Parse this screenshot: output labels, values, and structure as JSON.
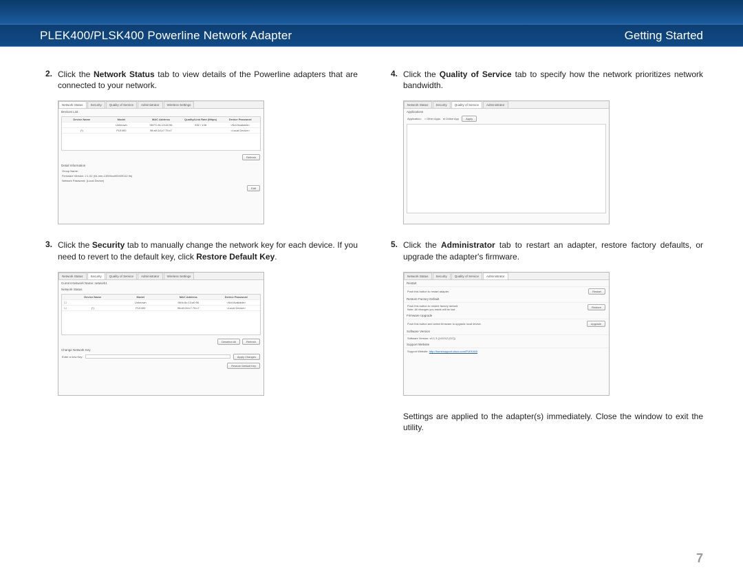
{
  "header": {
    "title": "PLEK400/PLSK400 Powerline Network Adapter",
    "section": "Getting Started"
  },
  "page_number": "7",
  "steps": {
    "s2": {
      "num": "2.",
      "pre": "Click the ",
      "bold": "Network Status",
      "post": " tab to view details of the Powerline adapters that are connected to your network."
    },
    "s3": {
      "num": "3.",
      "pre": "Click the ",
      "bold": "Security",
      "post_a": " tab to manually change the network key for each device. If you need to revert to the default key, click ",
      "bold2": "Restore Default Key",
      "post_b": "."
    },
    "s4": {
      "num": "4.",
      "pre": "Click the ",
      "bold": "Quality of Service",
      "post": " tab to specify how the network prioritizes network bandwidth."
    },
    "s5": {
      "num": "5.",
      "pre": "Click the ",
      "bold": "Administrator",
      "post": " tab to restart an adapter, restore factory defaults, or upgrade the adapter's firmware."
    }
  },
  "closing": "Settings are applied to the adapter(s) immediately. Close the window to exit the utility.",
  "shot_tabs": [
    "Network Status",
    "Security",
    "Quality of Service",
    "Administrator",
    "Wireless Settings"
  ],
  "ns": {
    "section": "Devices List",
    "cols": [
      "Device Name",
      "Model",
      "MAC Address",
      "Quality/Link Rate (Mbps)",
      "Device Password"
    ],
    "rows": [
      [
        "",
        "Unknown",
        "98:FC:8c:13:a0:96",
        "532 / 138",
        "<Not Available>"
      ],
      [
        "(*)",
        "PLE400",
        "98:a0:2d:c7:75:c7",
        "",
        "<Local Device>"
      ]
    ],
    "refresh": "Refresh",
    "detail": "Detail Information",
    "group": "Group Name:",
    "fw": "Firmware Version:   2.1.02 (04-mm-13000cc000409112.9s)",
    "np": "Network Password:   (Local Device)",
    "edit": "Edit"
  },
  "sec": {
    "cur": "Current Network Name:   network1",
    "status": "Network Status",
    "cols": [
      "",
      "Device Name",
      "Model",
      "MAC Address",
      "Device Password"
    ],
    "rows": [
      [
        "☐",
        "",
        "Unknown",
        "98:fc:8c:13:a0:96",
        "<Not Available>"
      ],
      [
        "☐",
        "(*)",
        "PLE400",
        "98:a0:2d:c7:75:c7",
        "<Local Device>"
      ]
    ],
    "btn_deselect": "Deselect All",
    "btn_refresh": "Refresh",
    "change": "Change Network Key",
    "enter": "Enter a new Key:",
    "apply": "Apply Changes",
    "restore": "Restore Default Key"
  },
  "qos": {
    "section": "Applications",
    "label": "Application:",
    "opt1": "Other Apps",
    "opt2": "Online App",
    "apply": "Apply"
  },
  "adm": {
    "restart": "Restart",
    "restart_txt": "Push this button to restart adapter.",
    "restart_btn": "Restart",
    "restore": "Restore Factory Default",
    "restore_txt1": "Push this button to restore factory default.",
    "restore_txt2": "Note: All changes you made will be lost.",
    "restore_btn": "Restore",
    "fw": "Firmware Upgrade",
    "fw_txt": "Push this button and select firmware to upgrade local device.",
    "fw_btn": "Upgrade",
    "sv": "Software Version",
    "sv_val": "Software Version:   v0.1.3 (141012  [GC])",
    "sup": "Support Website",
    "sup_label": "Support Website:",
    "sup_link": "http://homesupport.cisco.com/PLEK400"
  }
}
